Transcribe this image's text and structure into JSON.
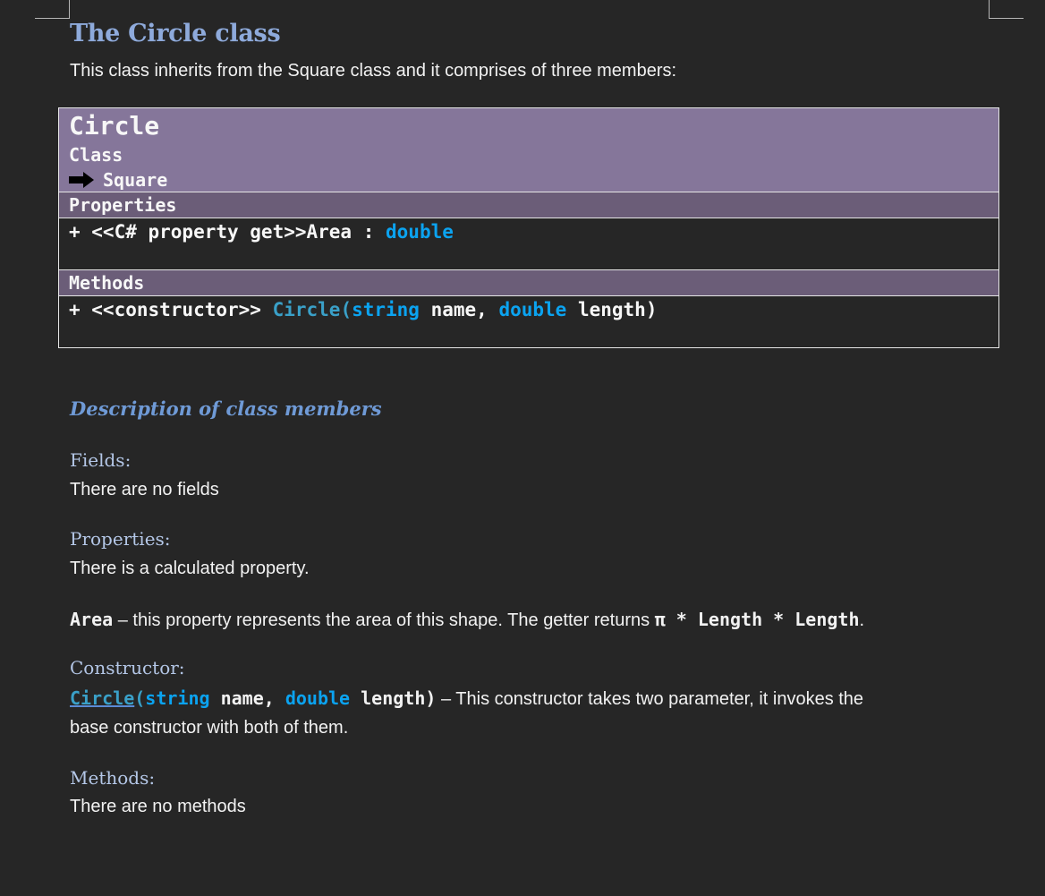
{
  "title": "The Circle class",
  "intro": "This class inherits from the Square class and it comprises of three members:",
  "uml": {
    "class_name": "Circle",
    "stereotype": "Class",
    "parent": "Square",
    "properties_header": "Properties",
    "property": {
      "prefix": "+ <<C# property get>>Area : ",
      "type": "double"
    },
    "methods_header": "Methods",
    "method": {
      "prefix": "+ <<constructor>> ",
      "name": "Circle",
      "open": "(",
      "type1": "string",
      "param1": " name, ",
      "type2": "double",
      "param2": " length)"
    }
  },
  "description": {
    "heading": "Description of class members",
    "fields_label": "Fields:",
    "fields_text": "There are no fields",
    "properties_label": "Properties:",
    "properties_text": "There is a calculated property.",
    "area": {
      "name": "Area",
      "text": " – this property represents the area of this shape. The getter returns ",
      "formula": "π * Length * Length",
      "end": "."
    },
    "constructor_label": "Constructor:",
    "constructor": {
      "name": "Circle",
      "open": "(",
      "type1": "string",
      "param1": " name, ",
      "type2": "double",
      "param2": " length)",
      "text1": " – This constructor takes two parameter, it invokes the",
      "text2": "base constructor with both of them."
    },
    "methods_label": "Methods:",
    "methods_text": "There are no methods"
  }
}
